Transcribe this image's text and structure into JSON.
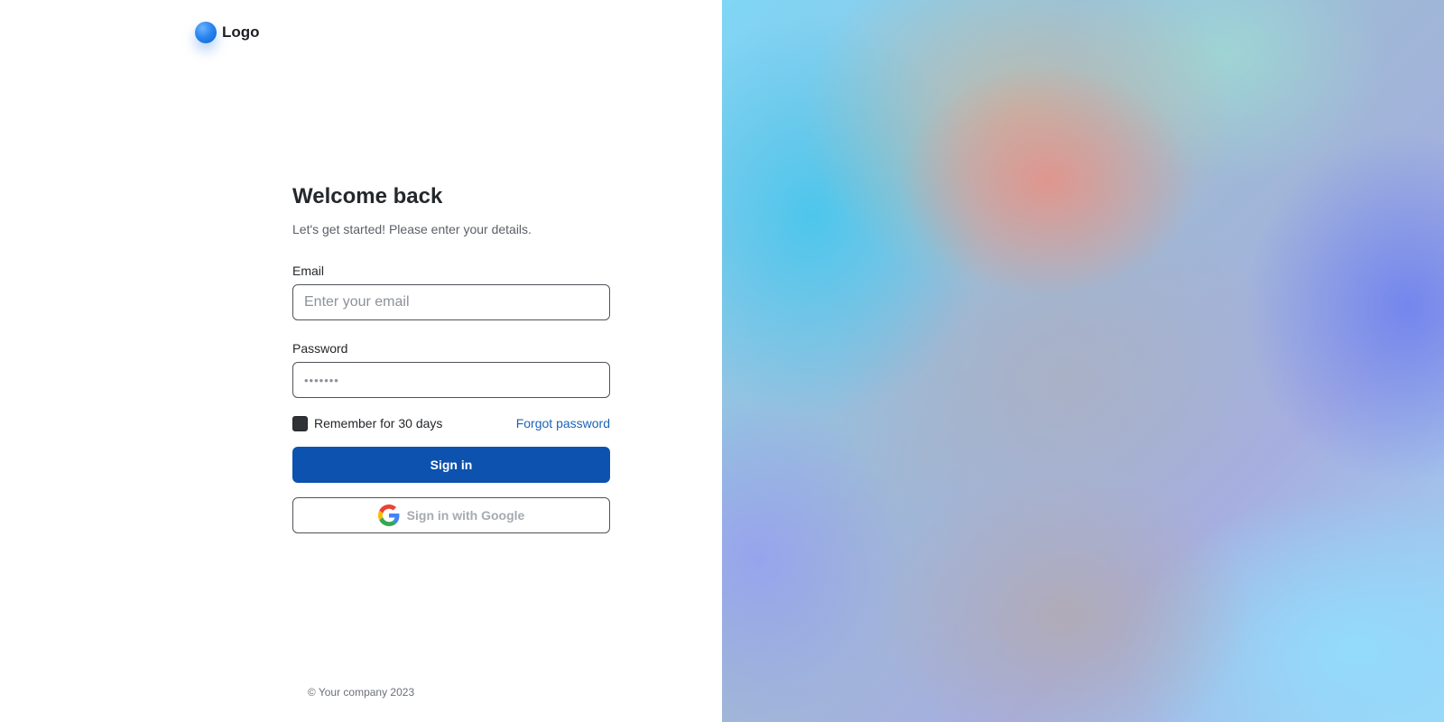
{
  "logo": {
    "text": "Logo"
  },
  "form": {
    "title": "Welcome back",
    "subtitle": "Let's get started! Please enter your details.",
    "email": {
      "label": "Email",
      "placeholder": "Enter your email",
      "value": ""
    },
    "password": {
      "label": "Password",
      "value": "•••••••"
    },
    "remember_label": "Remember for 30 days",
    "remember_checked": true,
    "forgot_label": "Forgot password",
    "signin_label": "Sign in",
    "google_label": "Sign in with Google"
  },
  "footer": {
    "text": "© Your company 2023"
  },
  "colors": {
    "primary": "#0c52ae",
    "link": "#1a63b8"
  }
}
